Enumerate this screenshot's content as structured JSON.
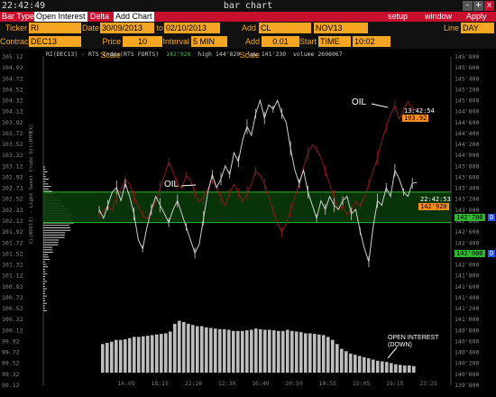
{
  "window": {
    "clock": "22:42:49",
    "title": "bar chart",
    "buttons": [
      "-",
      "+",
      "x"
    ]
  },
  "menu": {
    "items": [
      "Bar Type",
      "Open Interest",
      "Delta",
      "Add Chart"
    ],
    "right_items": [
      "setup",
      "window",
      "Apply"
    ]
  },
  "settings": {
    "ticker_label": "Ticker",
    "ticker": "RI",
    "date_label": "Date",
    "date_from": "30/09/2013",
    "date_to_label": "to",
    "date_to": "02/10/2013",
    "add_chart_label": "Add Chart",
    "add_chart": "CL",
    "add_chart_contract": "NOV13",
    "line_label": "Line",
    "line": "DAY",
    "contract_label": "Contract",
    "contract": "DEC13",
    "price_scale_label": "Price Scale",
    "price_scale": "10",
    "interval_label": "Interval",
    "interval": "5 MIN",
    "add_scale_label": "Add Scale",
    "add_scale": "0.01",
    "start_label": "Start",
    "start": "TIME",
    "start_time": "10:02"
  },
  "chart_header": {
    "symbol": "RI(DEC13) - RTS Index(RTS FORTS)",
    "last": "142'920",
    "high": "high 144'820",
    "low": "low 141'230",
    "volume": "volume 2696067"
  },
  "left_axis_label": "CL(NOV13) - Light Sweet Crude Oil(NYMEX)",
  "annotations": {
    "oil_1": "OIL",
    "oil_2": "OIL",
    "open_interest": "OPEN INTEREST\n(DOWN)"
  },
  "price_tags": {
    "oil_time": "13:42:54",
    "oil_price": "103.92",
    "rts_time": "22:42:53",
    "rts_price": "142'920",
    "band_top": "142'700",
    "band_bottom": "142'000",
    "band_marker": "D"
  },
  "colors": {
    "rts_line": "#d0d0d0",
    "oil_line": "#8b1a1a",
    "band": "#0a3a0a",
    "band_border": "#2db82d",
    "accent_orange": "#f5a623",
    "menu_red": "#c8102e",
    "oil_tag": "#ff8c1a"
  },
  "chart_data": {
    "type": "line",
    "left_axis": {
      "ticks": [
        "105.12",
        "104.92",
        "104.72",
        "104.52",
        "104.32",
        "104.12",
        "103.92",
        "103.72",
        "103.52",
        "103.32",
        "103.12",
        "102.92",
        "102.72",
        "102.52",
        "102.32",
        "102.12",
        "101.92",
        "101.72",
        "101.52",
        "101.32",
        "101.12",
        "100.92",
        "100.72",
        "100.52",
        "100.32",
        "100.12",
        "99.92",
        "99.72",
        "99.52",
        "99.32",
        "99.12"
      ],
      "range": [
        99.12,
        105.12
      ]
    },
    "right_axis": {
      "ticks": [
        "145'800",
        "145'600",
        "145'400",
        "145'200",
        "145'000",
        "144'800",
        "144'600",
        "144'400",
        "144'200",
        "144'000",
        "143'800",
        "143'600",
        "143'400",
        "143'200",
        "143'000",
        "142'800",
        "142'600",
        "142'400",
        "142'200",
        "142'000",
        "141'800",
        "141'600",
        "141'400",
        "141'200",
        "141'000",
        "140'800",
        "140'600",
        "140'400",
        "140'200",
        "140'000",
        "139'800"
      ],
      "range": [
        139800,
        145800
      ]
    },
    "x_ticks": [
      "14:05",
      "18:15",
      "22:20",
      "12:30",
      "16:40",
      "20:50",
      "10:55",
      "15:05",
      "19:15",
      "23:25"
    ],
    "band": [
      142000,
      142700
    ],
    "series": [
      {
        "name": "RI(DEC13)",
        "values": [
          142300,
          142100,
          142400,
          142700,
          142800,
          142500,
          142900,
          142600,
          142200,
          141600,
          141400,
          141900,
          142300,
          142600,
          142400,
          142200,
          142000,
          142300,
          142500,
          142200,
          141900,
          141600,
          141300,
          141500,
          142100,
          142700,
          143100,
          142800,
          143000,
          143300,
          143100,
          143600,
          143400,
          143900,
          144200,
          144000,
          144500,
          144800,
          144400,
          144700,
          144600,
          144800,
          144500,
          144300,
          143700,
          143200,
          142900,
          143200,
          142700,
          142400,
          142100,
          142500,
          142300,
          142600,
          142400,
          142300,
          142500,
          142600,
          142200,
          142300,
          141800,
          141400,
          141100,
          141900,
          142500,
          142400,
          142800,
          142600,
          143200,
          143000,
          142700,
          142600,
          142900,
          142920
        ]
      },
      {
        "name": "CL(NOV13)",
        "values": [
          101.5,
          101.6,
          101.7,
          101.6,
          101.9,
          102.1,
          102.3,
          102.2,
          101.9,
          101.7,
          101.5,
          101.4,
          101.6,
          101.8,
          102.1,
          102.4,
          102.7,
          102.5,
          102.2,
          102.1,
          102.4,
          102.3,
          102.0,
          101.8,
          101.9,
          102.1,
          102.3,
          102.1,
          101.9,
          101.7,
          102.0,
          102.2,
          102.0,
          101.8,
          102.0,
          102.2,
          102.5,
          102.4,
          102.2,
          101.9,
          101.6,
          101.3,
          101.1,
          101.3,
          101.6,
          101.9,
          102.2,
          102.6,
          102.9,
          103.1,
          103.0,
          102.8,
          102.5,
          102.2,
          101.9,
          101.6,
          101.7,
          101.5,
          101.6,
          101.8,
          101.7,
          101.9,
          102.2,
          102.5,
          102.8,
          103.2,
          103.5,
          103.8,
          104.0,
          103.7,
          103.9,
          104.1,
          103.9,
          103.92
        ]
      }
    ],
    "open_interest": {
      "ylim": [
        0,
        1
      ],
      "values": [
        0.48,
        0.5,
        0.52,
        0.55,
        0.55,
        0.56,
        0.58,
        0.6,
        0.6,
        0.61,
        0.62,
        0.63,
        0.64,
        0.65,
        0.66,
        0.69,
        0.82,
        0.87,
        0.85,
        0.82,
        0.8,
        0.78,
        0.78,
        0.76,
        0.75,
        0.74,
        0.73,
        0.73,
        0.72,
        0.7,
        0.7,
        0.7,
        0.71,
        0.72,
        0.74,
        0.73,
        0.72,
        0.72,
        0.71,
        0.7,
        0.7,
        0.72,
        0.7,
        0.69,
        0.68,
        0.66,
        0.66,
        0.65,
        0.64,
        0.63,
        0.6,
        0.55,
        0.48,
        0.4,
        0.36,
        0.32,
        0.3,
        0.28,
        0.26,
        0.24,
        0.22,
        0.2,
        0.19,
        0.18,
        0.16,
        0.14,
        0.13,
        0.12,
        0.12,
        0.11
      ]
    }
  }
}
